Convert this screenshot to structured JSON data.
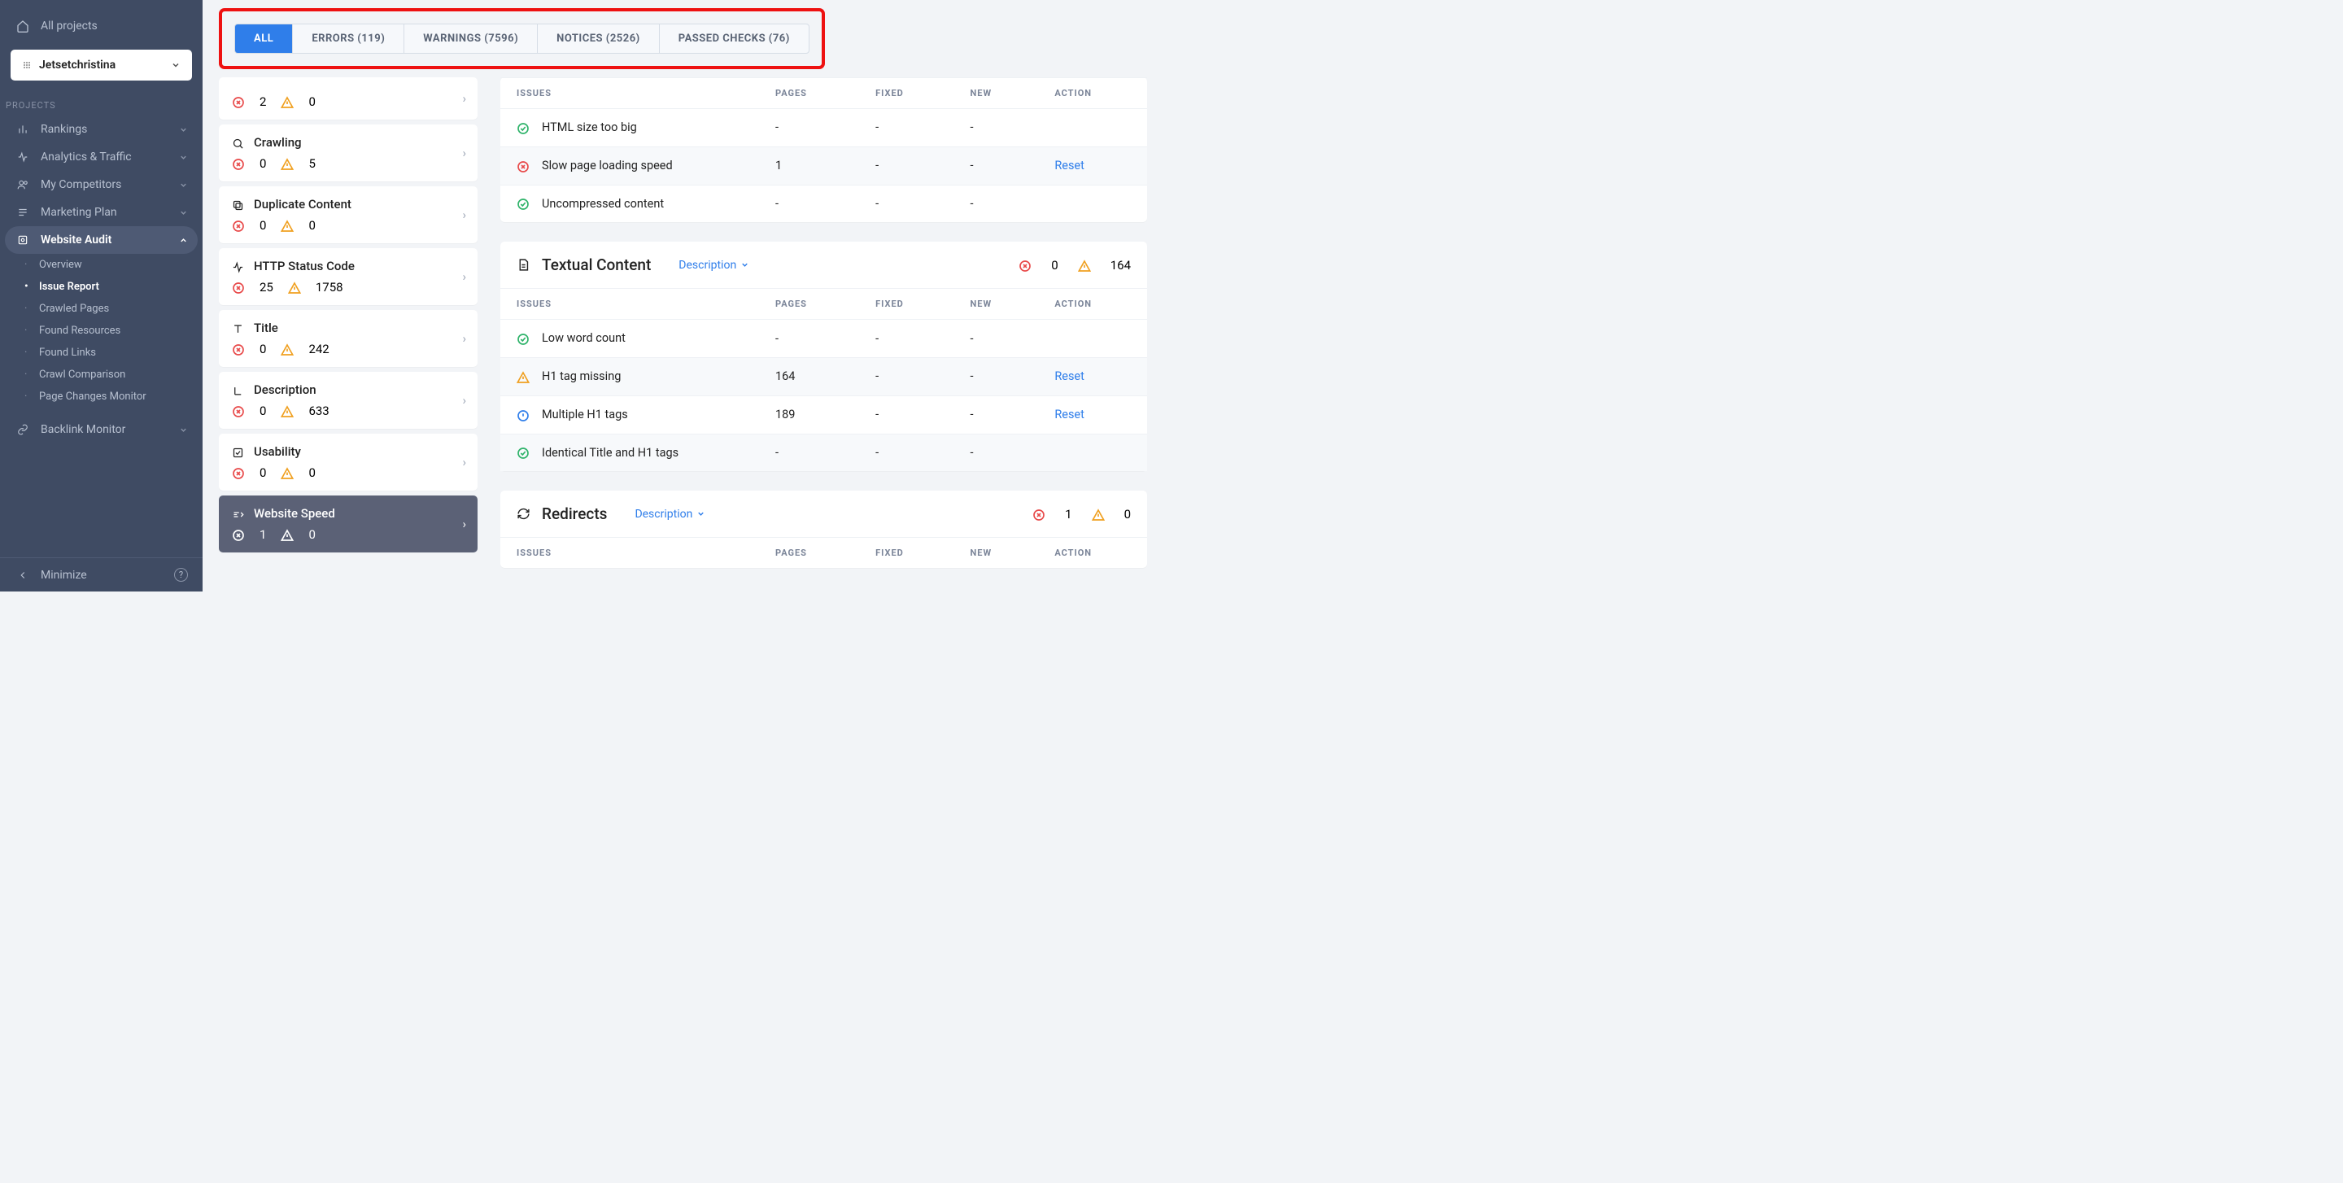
{
  "sidebar": {
    "all_projects": "All projects",
    "project_picker": "Jetsetchristina",
    "section_label": "PROJECTS",
    "items": [
      {
        "label": "Rankings"
      },
      {
        "label": "Analytics & Traffic"
      },
      {
        "label": "My Competitors"
      },
      {
        "label": "Marketing Plan"
      },
      {
        "label": "Website Audit"
      }
    ],
    "sub_items": [
      {
        "label": "Overview"
      },
      {
        "label": "Issue Report"
      },
      {
        "label": "Crawled Pages"
      },
      {
        "label": "Found Resources"
      },
      {
        "label": "Found Links"
      },
      {
        "label": "Crawl Comparison"
      },
      {
        "label": "Page Changes Monitor"
      }
    ],
    "backlink": "Backlink Monitor",
    "minimize": "Minimize"
  },
  "tabs": [
    {
      "label": "ALL"
    },
    {
      "label": "ERRORS (119)"
    },
    {
      "label": "WARNINGS (7596)"
    },
    {
      "label": "NOTICES (2526)"
    },
    {
      "label": "PASSED CHECKS (76)"
    }
  ],
  "categories": [
    {
      "title": "",
      "err": "2",
      "warn": "0",
      "has_title": false
    },
    {
      "title": "Crawling",
      "err": "0",
      "warn": "5",
      "has_title": true
    },
    {
      "title": "Duplicate Content",
      "err": "0",
      "warn": "0",
      "has_title": true
    },
    {
      "title": "HTTP Status Code",
      "err": "25",
      "warn": "1758",
      "has_title": true
    },
    {
      "title": "Title",
      "err": "0",
      "warn": "242",
      "has_title": true
    },
    {
      "title": "Description",
      "err": "0",
      "warn": "633",
      "has_title": true
    },
    {
      "title": "Usability",
      "err": "0",
      "warn": "0",
      "has_title": true
    },
    {
      "title": "Website Speed",
      "err": "1",
      "warn": "0",
      "has_title": true,
      "active": true
    }
  ],
  "table_headers": {
    "issues": "ISSUES",
    "pages": "PAGES",
    "fixed": "FIXED",
    "new": "NEW",
    "action": "ACTION"
  },
  "panels": [
    {
      "rows": [
        {
          "ic": "ok",
          "name": "HTML size too big",
          "pages": "-",
          "fixed": "-",
          "new": "-",
          "action": ""
        },
        {
          "ic": "err",
          "name": "Slow page loading speed",
          "pages": "1",
          "fixed": "-",
          "new": "-",
          "action": "Reset",
          "striped": true
        },
        {
          "ic": "ok",
          "name": "Uncompressed content",
          "pages": "-",
          "fixed": "-",
          "new": "-",
          "action": ""
        }
      ]
    },
    {
      "title": "Textual Content",
      "desc": "Description",
      "err": "0",
      "warn": "164",
      "rows": [
        {
          "ic": "ok",
          "name": "Low word count",
          "pages": "-",
          "fixed": "-",
          "new": "-",
          "action": ""
        },
        {
          "ic": "warn",
          "name": "H1 tag missing",
          "pages": "164",
          "fixed": "-",
          "new": "-",
          "action": "Reset",
          "striped": true
        },
        {
          "ic": "info",
          "name": "Multiple H1 tags",
          "pages": "189",
          "fixed": "-",
          "new": "-",
          "action": "Reset"
        },
        {
          "ic": "ok",
          "name": "Identical Title and H1 tags",
          "pages": "-",
          "fixed": "-",
          "new": "-",
          "action": "",
          "striped": true
        }
      ]
    },
    {
      "title": "Redirects",
      "desc": "Description",
      "err": "1",
      "warn": "0",
      "rows": []
    }
  ]
}
